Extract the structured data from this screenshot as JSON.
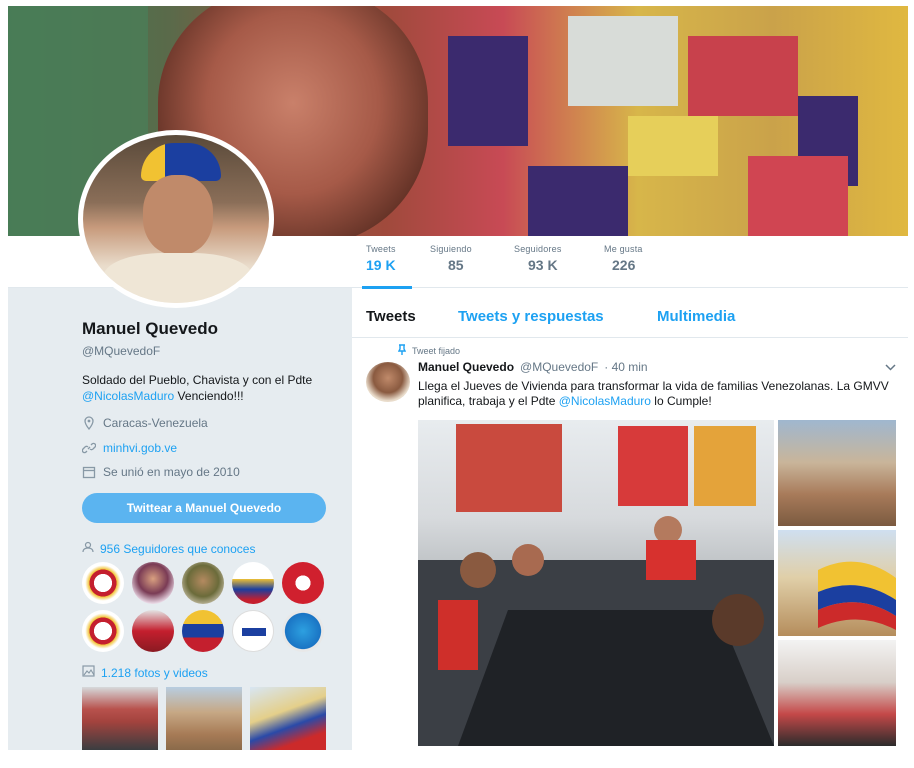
{
  "stats": [
    {
      "label": "Tweets",
      "value": "19 K",
      "active": true
    },
    {
      "label": "Siguiendo",
      "value": "85",
      "active": false
    },
    {
      "label": "Seguidores",
      "value": "93 K",
      "active": false
    },
    {
      "label": "Me gusta",
      "value": "226",
      "active": false
    }
  ],
  "profile": {
    "name": "Manuel Quevedo",
    "handle": "@MQuevedoF",
    "bio_pre": "Soldado del Pueblo, Chavista y con el Pdte ",
    "bio_link": "@NicolasMaduro",
    "bio_post": " Venciendo!!!",
    "location": "Caracas-Venezuela",
    "website": "minhvi.gob.ve",
    "joined": "Se unió en mayo de 2010",
    "tweet_to_label": "Twittear a Manuel Quevedo",
    "followers_known": "956 Seguidores que conoces",
    "photos_label": "1.218 fotos y videos"
  },
  "tabs": [
    "Tweets",
    "Tweets y respuestas",
    "Multimedia"
  ],
  "tweet": {
    "pinned_label": "Tweet fijado",
    "name": "Manuel Quevedo",
    "handle": "@MQuevedoF",
    "time": "· 40 min",
    "text_pre": "Llega el Jueves de Vivienda para transformar la vida de familias Venezolanas. La GMVV planifica, trabaja y el Pdte ",
    "text_link": "@NicolasMaduro",
    "text_post": " lo Cumple!"
  },
  "colors": {
    "accent": "#1da1f2",
    "sidebar_bg": "#e6ecf0"
  }
}
